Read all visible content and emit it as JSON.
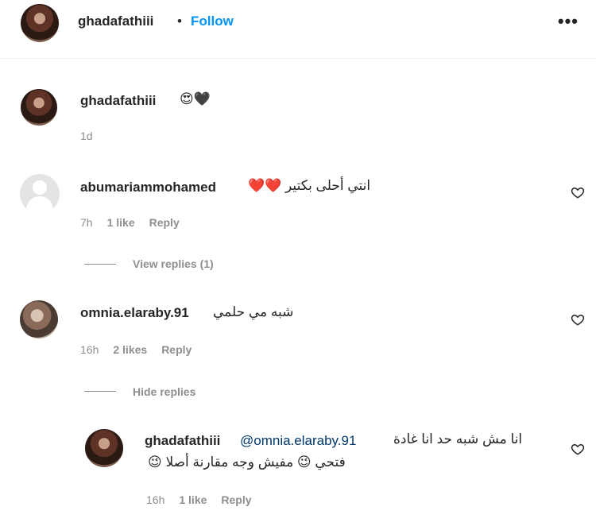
{
  "header": {
    "username": "ghadafathiii",
    "separator": "•",
    "follow": "Follow",
    "more": "•••"
  },
  "caption": {
    "username": "ghadafathiii",
    "emoji": "😍🖤",
    "time": "1d"
  },
  "comments": [
    {
      "username": "abumariammohamed",
      "text": "انتي أحلى بكتير ❤️❤️",
      "time": "7h",
      "likes": "1 like",
      "reply": "Reply",
      "view_replies": "View replies (1)"
    },
    {
      "username": "omnia.elaraby.91",
      "text": "شبه مي حلمي",
      "time": "16h",
      "likes": "2 likes",
      "reply": "Reply",
      "hide_replies": "Hide replies"
    }
  ],
  "reply": {
    "username": "ghadafathiii",
    "mention": "@omnia.elaraby.91",
    "text_line1": "انا مش شبه حد انا غادة",
    "text_line2": "فتحي 😉 مفيش وجه مقارنة أصلا 😉",
    "time": "16h",
    "likes": "1 like",
    "reply": "Reply"
  }
}
